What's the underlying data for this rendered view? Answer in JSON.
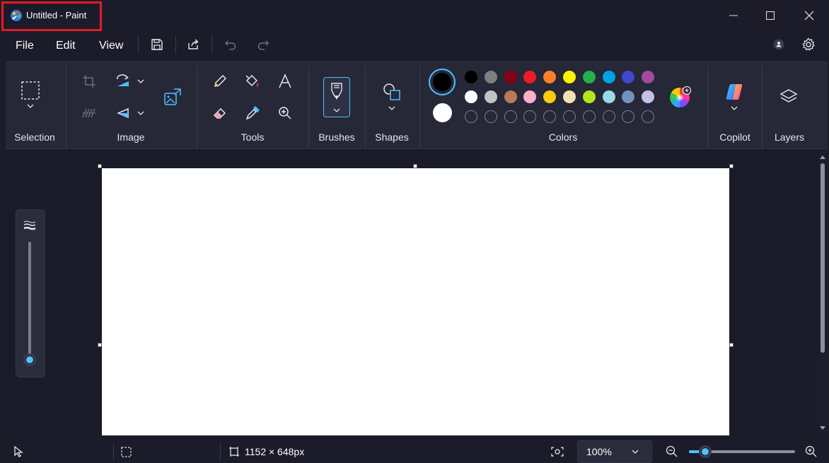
{
  "window": {
    "title": "Untitled - Paint",
    "icon": "paint-palette-icon",
    "controls": [
      "minimize-icon",
      "maximize-icon",
      "close-icon"
    ]
  },
  "menu": {
    "items": [
      "File",
      "Edit",
      "View"
    ],
    "quick_actions": [
      "save-icon",
      "share-icon",
      "undo-icon",
      "redo-icon"
    ],
    "right_actions": [
      "account-icon",
      "gear-icon"
    ]
  },
  "ribbon": {
    "groups": {
      "selection": "Selection",
      "image": "Image",
      "tools": "Tools",
      "brushes": "Brushes",
      "shapes": "Shapes",
      "colors": "Colors",
      "copilot": "Copilot",
      "layers": "Layers"
    },
    "primary_color": "#000000",
    "secondary_color": "#ffffff",
    "palette_row1": [
      "#000000",
      "#7f7f7f",
      "#880015",
      "#ed1c24",
      "#ff7f27",
      "#fff200",
      "#22b14c",
      "#00a2e8",
      "#3f48cc",
      "#a349a4"
    ],
    "palette_row2": [
      "#ffffff",
      "#c3c3c3",
      "#b97a57",
      "#ffaec9",
      "#ffc90e",
      "#efe4b0",
      "#b5e61d",
      "#99d9ea",
      "#7092be",
      "#c8bfe7"
    ],
    "custom_slots": 10
  },
  "status": {
    "canvas_size": "1152 × 648px",
    "zoom": "100%",
    "icons": [
      "pointer-icon",
      "selection-size-icon",
      "canvas-size-icon",
      "fit-to-window-icon",
      "zoom-out-icon",
      "zoom-in-icon"
    ]
  },
  "colors": {
    "accent": "#4cc2ff",
    "highlight_border": "#e41b23"
  }
}
